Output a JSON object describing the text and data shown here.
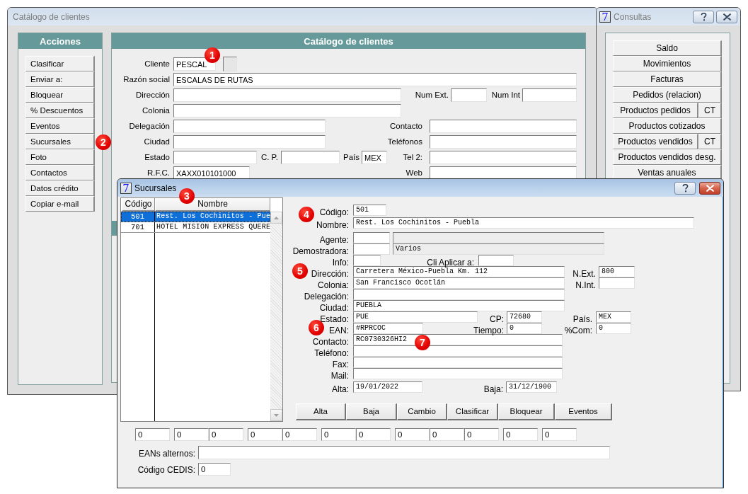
{
  "catalog_window": {
    "title": "Catálogo de clientes",
    "active": false,
    "actions_panel": {
      "title": "Acciones",
      "buttons": [
        "Clasificar",
        "Enviar a:",
        "Bloquear",
        "% Descuentos",
        "Eventos",
        "Sucursales",
        "Foto",
        "Contactos",
        "Datos crédito",
        "Copiar e-mail"
      ]
    },
    "client_panel": {
      "title": "Catálogo de clientes",
      "fields": {
        "cliente": {
          "label": "Cliente",
          "value": "PESCAL",
          "aux_field": {
            "disabled": true
          }
        },
        "razon_social": {
          "label": "Razón social",
          "value": "ESCALAS DE RUTAS"
        },
        "direccion": {
          "label": "Dirección"
        },
        "num_ext": {
          "label": "Num Ext."
        },
        "num_int": {
          "label": "Num Int"
        },
        "colonia": {
          "label": "Colonia"
        },
        "delegacion": {
          "label": "Delegación"
        },
        "contacto": {
          "label": "Contacto"
        },
        "ciudad": {
          "label": "Ciudad"
        },
        "telefonos": {
          "label": "Teléfonos"
        },
        "estado": {
          "label": "Estado"
        },
        "cp": {
          "label": "C. P."
        },
        "pais": {
          "label": "País",
          "value": "MEX"
        },
        "tel2": {
          "label": "Tel 2:"
        },
        "rfc": {
          "label": "R.F.C.",
          "value": "XAXX010101000"
        },
        "web": {
          "label": "Web"
        }
      }
    }
  },
  "queries_window": {
    "logo": "7",
    "title": "Consultas",
    "active": false,
    "buttons": [
      {
        "label": "Saldo"
      },
      {
        "label": "Movimientos"
      },
      {
        "label": "Facturas"
      },
      {
        "label": "Pedidos (relacion)"
      },
      {
        "label": "Productos pedidos",
        "side_button": "CT"
      },
      {
        "label": "Productos cotizados"
      },
      {
        "label": "Productos vendidos",
        "side_button": "CT"
      },
      {
        "label": "Productos vendidos desg."
      },
      {
        "label": "Ventas anuales"
      }
    ]
  },
  "branches_window": {
    "logo": "7",
    "title": "Sucursales",
    "active": true,
    "list": {
      "columns": [
        "Código",
        "Nombre"
      ],
      "rows": [
        {
          "code": "501",
          "name": "Rest. Los Cochinitos - Pue",
          "selected": true
        },
        {
          "code": "701",
          "name": "HOTEL MISION EXPRESS QUERE",
          "selected": false
        }
      ]
    },
    "form": {
      "codigo": {
        "label": "Código:",
        "value": "501"
      },
      "nombre": {
        "label": "Nombre:",
        "value": "Rest. Los Cochinitos - Puebla"
      },
      "agente": {
        "label": "Agente:",
        "name_field": {
          "disabled": true
        }
      },
      "demostradora": {
        "label": "Demostradora:",
        "name_field": {
          "disabled": true,
          "value": "Varios"
        }
      },
      "info": {
        "label": "Info:"
      },
      "cli_aplicar": {
        "label": "Cli Aplicar a:"
      },
      "direccion": {
        "label": "Dirección:",
        "value": "Carretera México-Puebla Km. 112"
      },
      "n_ext": {
        "label": "N.Ext.",
        "value": "800"
      },
      "colonia": {
        "label": "Colonia:",
        "value": "San Francisco Ocotlán"
      },
      "n_int": {
        "label": "N.Int."
      },
      "delegacion": {
        "label": "Delegación:"
      },
      "ciudad": {
        "label": "Ciudad:",
        "value": "PUEBLA"
      },
      "estado": {
        "label": "Estado:",
        "value": "PUE"
      },
      "cp": {
        "label": "CP:",
        "value": "72680"
      },
      "pais": {
        "label": "País.",
        "value": "MEX"
      },
      "ean": {
        "label": "EAN:",
        "value": "#RPRCOC"
      },
      "tiempo": {
        "label": "Tiempo:",
        "value": "0"
      },
      "comision": {
        "label": "%Com:",
        "value": "0"
      },
      "contacto": {
        "label": "Contacto:",
        "value": "RC0730326HI2"
      },
      "telefono": {
        "label": "Teléfono:"
      },
      "fax": {
        "label": "Fax:"
      },
      "mail": {
        "label": "Mail:"
      },
      "alta": {
        "label": "Alta:",
        "value": "19/01/2022"
      },
      "baja": {
        "label": "Baja:",
        "value": "31/12/1900"
      }
    },
    "buttons": [
      "Alta",
      "Baja",
      "Cambio",
      "Clasificar",
      "Bloquear",
      "Eventos"
    ],
    "counter_groups": [
      [
        "0"
      ],
      [
        "0",
        "0"
      ],
      [
        "0",
        "0"
      ],
      [
        "0",
        "0"
      ],
      [
        "0",
        "0",
        "0"
      ],
      [
        "0"
      ],
      [
        "0"
      ]
    ],
    "alt_eans": {
      "label": "EANs alternos:"
    },
    "cedis": {
      "label": "Código CEDIS:",
      "value": "0"
    }
  },
  "callouts": [
    "1",
    "2",
    "3",
    "4",
    "5",
    "6",
    "7"
  ]
}
